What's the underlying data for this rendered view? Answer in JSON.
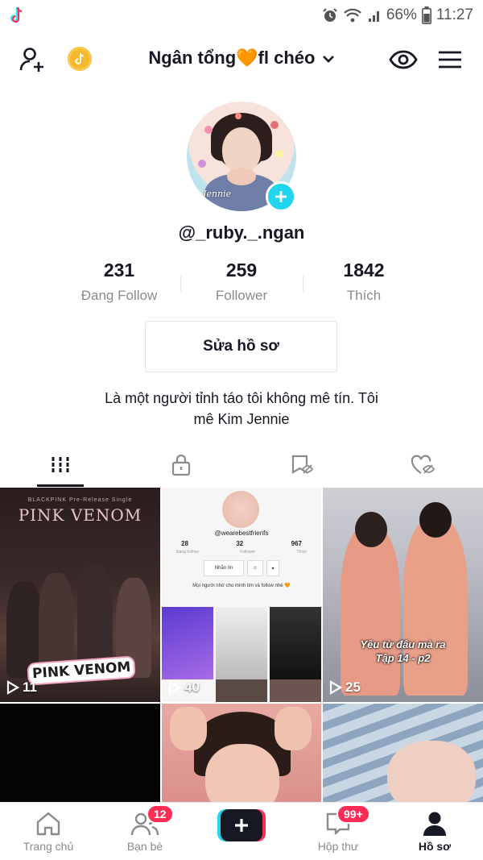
{
  "status_bar": {
    "battery": "66%",
    "time": "11:27"
  },
  "header": {
    "profile_name": "Ngân tổng🧡fl chéo",
    "icons": [
      "add-user-icon",
      "coin-icon",
      "chevron-down-icon",
      "eye-icon",
      "menu-icon"
    ]
  },
  "profile": {
    "avatar_signature": "Jennie",
    "username": "@_ruby._.ngan",
    "stats": [
      {
        "value": "231",
        "label": "Đang Follow"
      },
      {
        "value": "259",
        "label": "Follower"
      },
      {
        "value": "1842",
        "label": "Thích"
      }
    ],
    "edit_button": "Sửa hồ sơ",
    "bio_line1": "Là một người tỉnh táo tôi không mê tín. Tôi",
    "bio_line2": "mê Kim Jennie"
  },
  "tabs": [
    "videos-grid-icon",
    "private-lock-icon",
    "hidden-favorites-icon",
    "hidden-likes-icon"
  ],
  "videos": [
    {
      "views": "11",
      "overlay_small": "BLACKPINK Pre-Release Single",
      "overlay_title": "PINK VENOM",
      "sticker": "PINK VENOM"
    },
    {
      "views": "40",
      "mini_username": "@wearebestfrienfs",
      "mini_stats": [
        "28",
        "32",
        "967"
      ],
      "mini_labels": [
        "Đang Follow",
        "Follower",
        "Thích"
      ],
      "mini_button": "Nhắn tin",
      "mini_bio": "Mọi người nhớ cho mình tim và follow nhé 🧡"
    },
    {
      "views": "25",
      "caption_line1": "Yêu từ đâu mà ra",
      "caption_line2": "Tập 14 - p2"
    },
    {
      "views": ""
    },
    {
      "views": ""
    },
    {
      "views": ""
    }
  ],
  "bottom_nav": {
    "home": "Trang chủ",
    "friends": "Bạn bè",
    "friends_badge": "12",
    "inbox": "Hộp thư",
    "inbox_badge": "99+",
    "profile": "Hồ sơ"
  },
  "colors": {
    "accent_cyan": "#20d5ec",
    "accent_red": "#fe2c55",
    "text_primary": "#161823",
    "text_secondary": "#8a8b91"
  }
}
